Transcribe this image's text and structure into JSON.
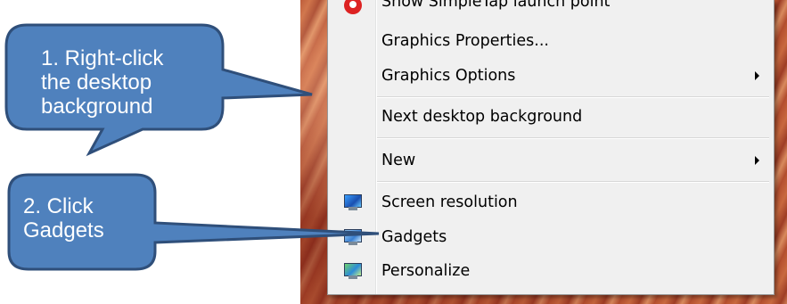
{
  "context_menu": {
    "items": [
      {
        "label": "Show SimpleTap launch point",
        "icon": "simpletap-icon"
      },
      {
        "label": "Graphics Properties...",
        "icon": ""
      },
      {
        "label": "Graphics Options",
        "icon": "",
        "submenu": true
      },
      {
        "label": "Next desktop background",
        "icon": ""
      },
      {
        "label": "New",
        "icon": "",
        "submenu": true
      },
      {
        "label": "Screen resolution",
        "icon": "screen-resolution-icon"
      },
      {
        "label": "Gadgets",
        "icon": "gadgets-icon"
      },
      {
        "label": "Personalize",
        "icon": "personalize-icon"
      }
    ]
  },
  "callouts": {
    "step1": "1. Right-click\nthe desktop\nbackground",
    "step2": "2. Click\nGadgets"
  },
  "colors": {
    "callout_fill": "#4f81bd",
    "callout_border": "#2f4f7a",
    "menu_background": "#f0f0f0"
  }
}
